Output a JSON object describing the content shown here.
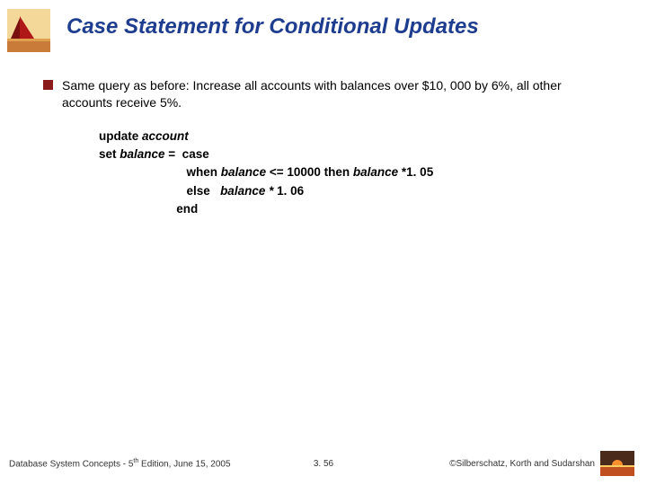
{
  "title": "Case Statement for Conditional Updates",
  "bullet": "Same query as before: Increase all accounts with balances over $10, 000 by 6%, all other accounts receive 5%.",
  "code": {
    "l1_kw": "update ",
    "l1_id": "account",
    "l2_kw": "set ",
    "l2_id": "balance",
    "l2_rest": " =  case",
    "l3_pad": "                          ",
    "l3_kw1": "when ",
    "l3_id1": "balance",
    "l3_mid": " <= 10000 ",
    "l3_kw2": "then ",
    "l3_id2": "balance ",
    "l3_end": "*1. 05",
    "l4_pad": "                          ",
    "l4_kw": "else   ",
    "l4_id": "balance * ",
    "l4_end": "1. 06",
    "l5_pad": "                       ",
    "l5_kw": "end"
  },
  "footer": {
    "left_a": "Database System Concepts - 5",
    "left_sup": "th",
    "left_b": " Edition, June 15, 2005",
    "center": "3. 56",
    "right": "©Silberschatz, Korth and Sudarshan"
  }
}
